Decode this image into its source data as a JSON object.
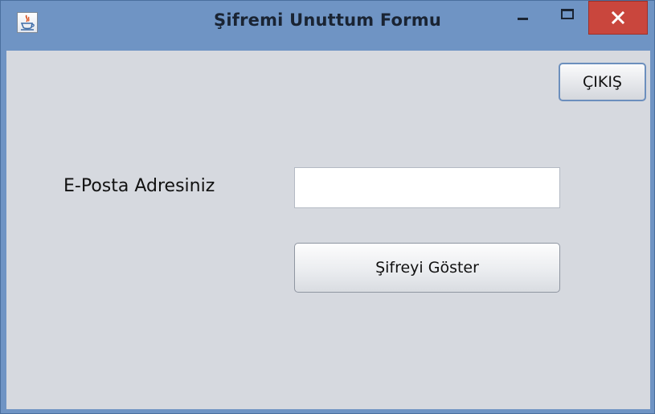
{
  "window": {
    "title": "Şifremi Unuttum Formu",
    "app_icon": "java-cup-icon",
    "controls": {
      "minimize_icon": "minimize-icon",
      "maximize_icon": "maximize-icon",
      "close_icon": "close-icon"
    },
    "colors": {
      "titlebar": "#6f94c4",
      "close_button": "#c9463d",
      "client_background": "#d6d9df"
    }
  },
  "form": {
    "exit_button_label": "ÇIKIŞ",
    "email_label": "E-Posta Adresiniz",
    "email_value": "",
    "show_password_button_label": "Şifreyi Göster"
  }
}
